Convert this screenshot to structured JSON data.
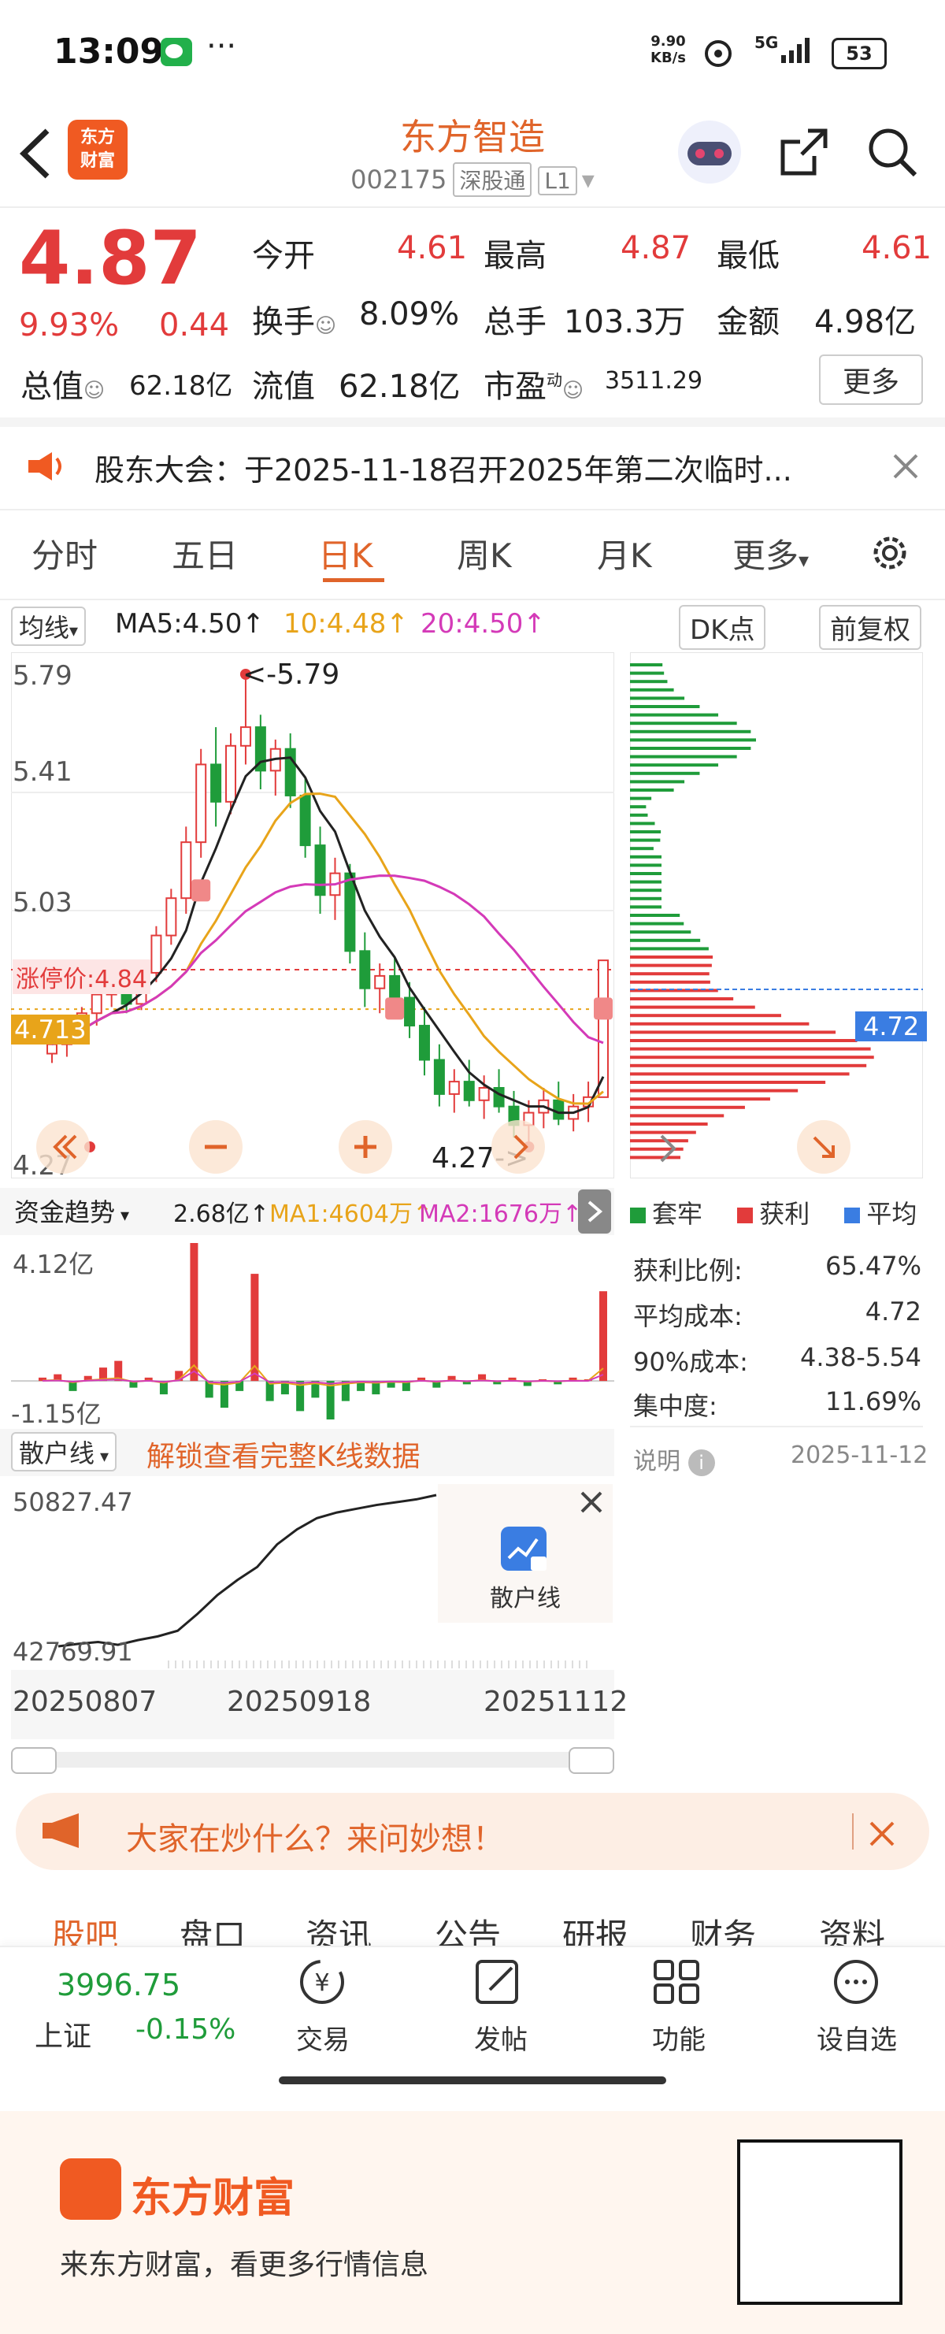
{
  "status_bar": {
    "time": "13:09",
    "dots": "···",
    "net_speed_top": "9.90",
    "net_speed_bottom": "KB/s",
    "signal": "5G",
    "battery": "53"
  },
  "header": {
    "name": "东方智造",
    "code": "002175",
    "tag1": "深股通",
    "tag2": "L1",
    "logo_line1": "东方",
    "logo_line2": "财富"
  },
  "quote": {
    "price": "4.87",
    "change_pct": "9.93%",
    "change": "0.44",
    "open_label": "今开",
    "open": "4.61",
    "high_label": "最高",
    "high": "4.87",
    "low_label": "最低",
    "low": "4.61",
    "turnover_label": "换手",
    "turnover": "8.09%",
    "volume_label": "总手",
    "volume": "103.3万",
    "amount_label": "金额",
    "amount": "4.98亿",
    "mktcap_label": "总值",
    "mktcap": "62.18亿",
    "float_label": "流值",
    "float": "62.18亿",
    "pe_label": "市盈",
    "pe_superscript": "动",
    "pe": "3511.29",
    "more_label": "更多"
  },
  "notice": {
    "text": "股东大会：于2025-11-18召开2025年第二次临时..."
  },
  "tabs": [
    "分时",
    "五日",
    "日K",
    "周K",
    "月K",
    "更多"
  ],
  "tab_more_suffix": "▾",
  "active_tab": "日K",
  "ma_bar": {
    "type": "均线",
    "ma5": "MA5:4.50",
    "ma10": "10:4.48",
    "ma20": "20:4.50",
    "dk_button": "DK点",
    "adjust_button": "前复权"
  },
  "kline": {
    "y_top": "5.79",
    "y_2": "5.41",
    "y_3": "5.03",
    "y_bottom": "4.27",
    "limit_label": "涨停价:4.84",
    "current_label": "4.713",
    "max_annotation": "<-5.79",
    "min_annotation": "4.27->",
    "b_label": "B",
    "mu_label": "目"
  },
  "chip": {
    "avg_label": "4.72",
    "legend": [
      "套牢",
      "获利",
      "平均"
    ],
    "rows": [
      {
        "label": "获利比例:",
        "value": "65.47%"
      },
      {
        "label": "平均成本:",
        "value": "4.72"
      },
      {
        "label": "90%成本:",
        "value": "4.38-5.54"
      },
      {
        "label": "集中度:",
        "value": "11.69%"
      }
    ],
    "note_label": "说明",
    "note_date": "2025-11-12"
  },
  "fund": {
    "title": "资金趋势",
    "value": "2.68亿",
    "ma1": "MA1:4604万",
    "ma2": "MA2:1676万",
    "y_top": "4.12亿",
    "y_bottom": "-1.15亿"
  },
  "retail": {
    "title": "散户线",
    "unlock": "解锁查看完整K线数据",
    "y_top": "50827.47",
    "y_bottom": "42769.91",
    "locked_label": "散户线",
    "dates": [
      "20250807",
      "20250918",
      "20251112"
    ]
  },
  "banner": {
    "text": "大家在炒什么？来问妙想！"
  },
  "news_tabs": [
    "股吧",
    "盘口",
    "资讯",
    "公告",
    "研报",
    "财务",
    "资料"
  ],
  "bottom_bar": {
    "index_value": "3996.75",
    "index_name": "上证",
    "index_change": "-0.15%",
    "items": [
      "交易",
      "发帖",
      "功能",
      "设自选"
    ]
  },
  "footer": {
    "brand": "东方财富",
    "slogan": "来东方财富，看更多行情信息"
  },
  "colors": {
    "red": "#e23b3b",
    "green": "#1f9c3a",
    "orange": "#e0642a",
    "magenta": "#d43ab8",
    "ma10": "#e8a41a",
    "blue": "#3a7de2"
  },
  "chart_data": [
    {
      "type": "candlestick",
      "title": "日K",
      "ylim": [
        4.27,
        5.79
      ],
      "ma": {
        "MA5": 4.5,
        "MA10": 4.48,
        "MA20": 4.5
      },
      "candles": [
        [
          4.57,
          4.63,
          4.54,
          4.6
        ],
        [
          4.6,
          4.68,
          4.56,
          4.64
        ],
        [
          4.64,
          4.72,
          4.61,
          4.7
        ],
        [
          4.7,
          4.8,
          4.66,
          4.76
        ],
        [
          4.76,
          4.84,
          4.72,
          4.8
        ],
        [
          4.8,
          4.82,
          4.7,
          4.73
        ],
        [
          4.73,
          4.86,
          4.71,
          4.83
        ],
        [
          4.83,
          4.98,
          4.8,
          4.95
        ],
        [
          4.95,
          5.1,
          4.92,
          5.07
        ],
        [
          5.07,
          5.3,
          5.02,
          5.25
        ],
        [
          5.25,
          5.55,
          5.2,
          5.5
        ],
        [
          5.5,
          5.62,
          5.3,
          5.38
        ],
        [
          5.38,
          5.6,
          5.34,
          5.56
        ],
        [
          5.56,
          5.79,
          5.5,
          5.62
        ],
        [
          5.62,
          5.66,
          5.42,
          5.48
        ],
        [
          5.48,
          5.58,
          5.4,
          5.55
        ],
        [
          5.55,
          5.6,
          5.36,
          5.4
        ],
        [
          5.4,
          5.46,
          5.2,
          5.24
        ],
        [
          5.24,
          5.3,
          5.02,
          5.08
        ],
        [
          5.08,
          5.2,
          5.0,
          5.15
        ],
        [
          5.15,
          5.18,
          4.86,
          4.9
        ],
        [
          4.9,
          4.96,
          4.72,
          4.78
        ],
        [
          4.78,
          4.86,
          4.7,
          4.82
        ],
        [
          4.82,
          4.88,
          4.72,
          4.75
        ],
        [
          4.75,
          4.8,
          4.62,
          4.66
        ],
        [
          4.66,
          4.72,
          4.5,
          4.55
        ],
        [
          4.55,
          4.6,
          4.4,
          4.44
        ],
        [
          4.44,
          4.52,
          4.38,
          4.48
        ],
        [
          4.48,
          4.55,
          4.4,
          4.42
        ],
        [
          4.42,
          4.5,
          4.36,
          4.46
        ],
        [
          4.46,
          4.52,
          4.38,
          4.4
        ],
        [
          4.4,
          4.45,
          4.3,
          4.34
        ],
        [
          4.34,
          4.42,
          4.27,
          4.38
        ],
        [
          4.38,
          4.46,
          4.33,
          4.42
        ],
        [
          4.42,
          4.48,
          4.34,
          4.36
        ],
        [
          4.36,
          4.44,
          4.32,
          4.4
        ],
        [
          4.4,
          4.48,
          4.35,
          4.43
        ],
        [
          4.43,
          4.87,
          4.43,
          4.87
        ]
      ],
      "annotations": [
        {
          "label": "<-5.79",
          "value": 5.79
        },
        {
          "label": "4.27->",
          "value": 4.27
        }
      ],
      "limit_price": 4.84
    },
    {
      "type": "bar",
      "title": "资金趋势",
      "ylim": [
        -1.15,
        4.12
      ],
      "values": [
        0.1,
        0.2,
        -0.3,
        0.15,
        0.4,
        0.6,
        -0.2,
        0.1,
        -0.4,
        0.3,
        4.12,
        -0.5,
        -0.8,
        -0.3,
        3.2,
        -0.6,
        -0.4,
        -0.9,
        -0.5,
        -1.15,
        -0.6,
        -0.3,
        -0.4,
        -0.2,
        -0.3,
        0.1,
        -0.2,
        0.15,
        -0.1,
        0.2,
        -0.1,
        0.1,
        -0.15,
        0.05,
        -0.1,
        0.1,
        0.05,
        2.68
      ]
    },
    {
      "type": "line",
      "title": "散户线",
      "x": [
        "20250807",
        "20250918",
        "20251112"
      ],
      "ylim": [
        42769.91,
        50827.47
      ],
      "values": [
        42769.91,
        42900,
        43000,
        42850,
        43100,
        43300,
        43600,
        44500,
        45500,
        46300,
        47000,
        48200,
        49000,
        49600,
        49900,
        50100,
        50300,
        50450,
        50600,
        50827.47
      ]
    }
  ]
}
